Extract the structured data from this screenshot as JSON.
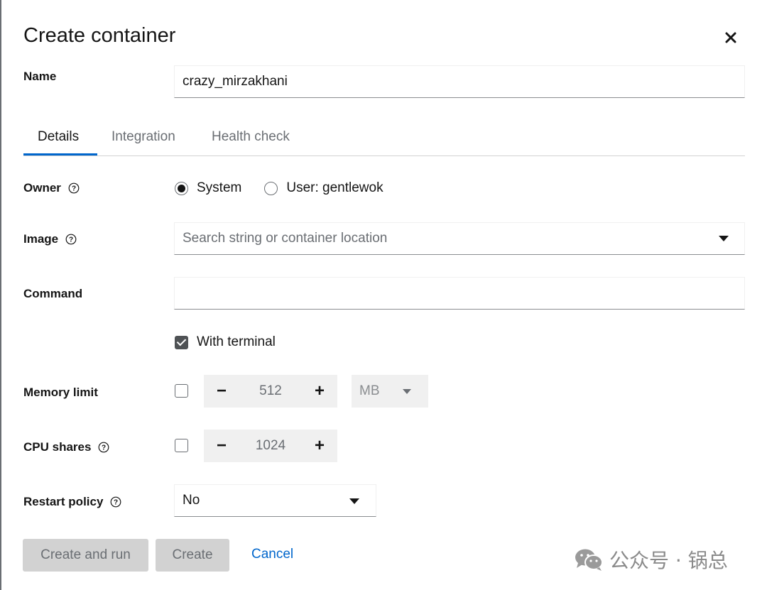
{
  "dialog": {
    "title": "Create container",
    "close_label": "Close"
  },
  "fields": {
    "name_label": "Name",
    "name_value": "crazy_mirzakhani",
    "owner_label": "Owner",
    "image_label": "Image",
    "image_placeholder": "Search string or container location",
    "command_label": "Command",
    "command_value": "",
    "memory_label": "Memory limit",
    "cpu_label": "CPU shares",
    "restart_label": "Restart policy"
  },
  "tabs": [
    {
      "label": "Details",
      "active": true
    },
    {
      "label": "Integration",
      "active": false
    },
    {
      "label": "Health check",
      "active": false
    }
  ],
  "owner_options": [
    {
      "label": "System",
      "checked": true
    },
    {
      "label": "User: gentlewok",
      "checked": false
    }
  ],
  "terminal": {
    "label": "With terminal",
    "checked": true
  },
  "memory": {
    "enabled": false,
    "value": "512",
    "unit": "MB",
    "minus": "−",
    "plus": "+"
  },
  "cpu": {
    "enabled": false,
    "value": "1024",
    "minus": "−",
    "plus": "+"
  },
  "restart": {
    "value": "No"
  },
  "footer": {
    "create_and_run": "Create and run",
    "create": "Create",
    "cancel": "Cancel"
  },
  "watermark": {
    "text": "公众号 · 锅总"
  },
  "colors": {
    "accent": "#0066cc",
    "disabled_bg": "#d2d2d2",
    "text": "#151515",
    "muted": "#6a6e73"
  },
  "icons": {
    "close": "close-icon",
    "help": "help-icon",
    "caret": "caret-down-icon",
    "wechat": "wechat-icon"
  }
}
